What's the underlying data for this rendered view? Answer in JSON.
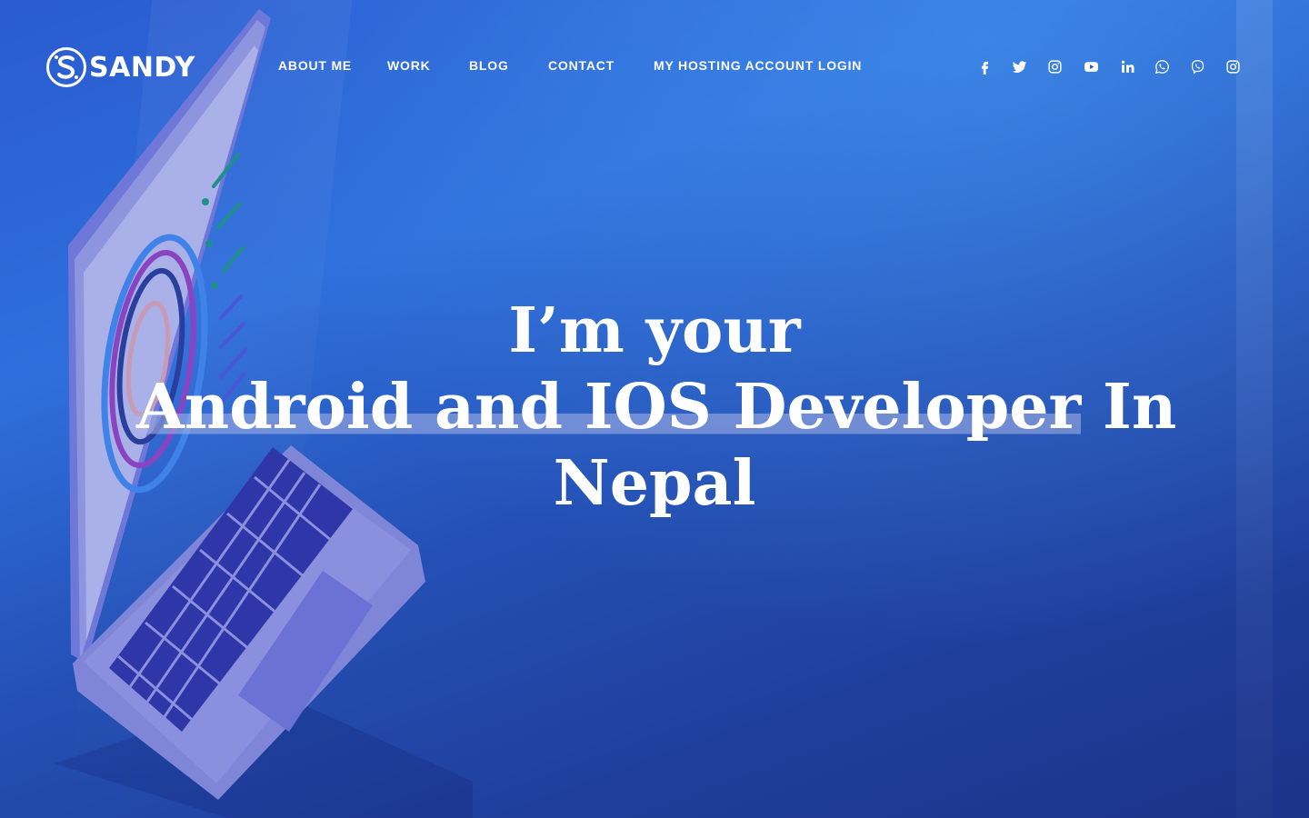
{
  "brand": {
    "name": "SANDY"
  },
  "nav": {
    "items": [
      {
        "label": "ABOUT ME"
      },
      {
        "label": "WORK"
      },
      {
        "label": "BLOG"
      },
      {
        "label": "CONTACT"
      },
      {
        "label": "MY HOSTING ACCOUNT LOGIN"
      }
    ]
  },
  "social": [
    {
      "icon": "facebook-icon"
    },
    {
      "icon": "twitter-icon"
    },
    {
      "icon": "instagram-icon"
    },
    {
      "icon": "youtube-icon"
    },
    {
      "icon": "linkedin-icon"
    },
    {
      "icon": "whatsapp-icon"
    },
    {
      "icon": "viber-icon"
    },
    {
      "icon": "instagram-icon"
    }
  ],
  "hero": {
    "line1": "I’m your",
    "highlight": "Android and IOS Developer",
    "line2_rest": " In",
    "line3": "Nepal"
  },
  "colors": {
    "background_top": "#2f6fdc",
    "background_bottom": "#1b3488",
    "text": "#ffffff",
    "highlight": "#aab4e6"
  }
}
